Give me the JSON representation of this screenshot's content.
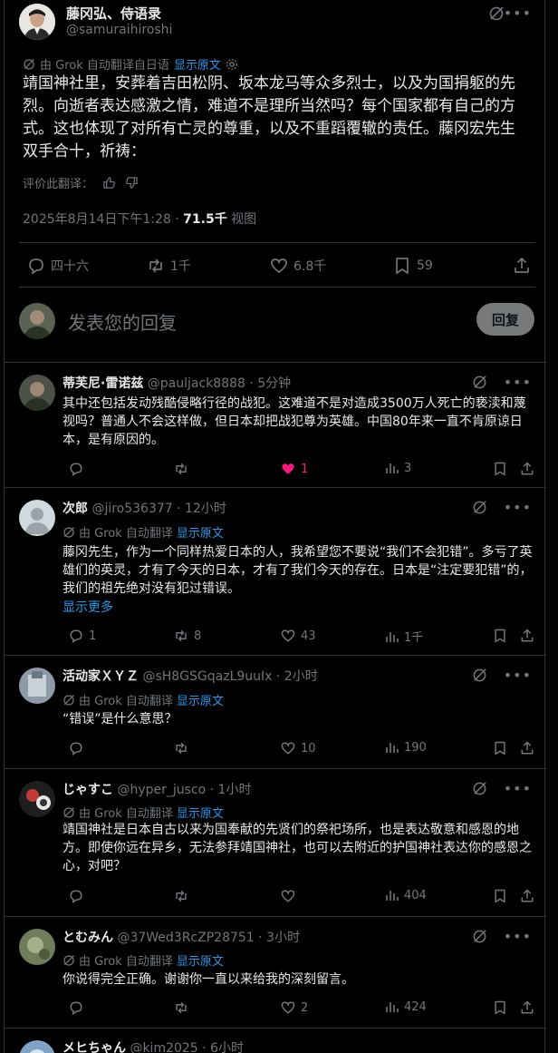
{
  "main": {
    "author_name": "藤冈弘、侍语录",
    "author_handle": "@samuraihiroshi",
    "translated_by": "由 Grok 自动翻译自日语",
    "show_original": "显示原文",
    "text": "靖国神社里，安葬着吉田松阴、坂本龙马等众多烈士，以及为国捐躯的先烈。向逝者表达感激之情，难道不是理所当然吗？每个国家都有自己的方式。这也体现了对所有亡灵的尊重，以及不重蹈覆辙的责任。藤冈宏先生双手合十，祈祷：",
    "rate_translation": "评价此翻译：",
    "timestamp": "2025年8月14日下午1:28",
    "views_count": "71.5千",
    "views_label": "视图",
    "reply_count": "四十六",
    "repost_count": "1千",
    "like_count": "6.8千",
    "bookmark_count": "59"
  },
  "composer": {
    "placeholder": "发表您的回复",
    "button": "回复"
  },
  "replies": [
    {
      "name": "蒂芙尼·雷诺兹",
      "handle": "@pauljack8888",
      "time": "· 5分钟",
      "translated": "",
      "show_original": "",
      "text": "其中还包括发动残酷侵略行径的战犯。这难道不是对造成3500万人死亡的亵渎和蔑视吗？普通人不会这样做，但日本却把战犯尊为英雄。中国80年来一直不肯原谅日本，是有原因的。",
      "show_more": "",
      "replies": "",
      "reposts": "",
      "likes": "1",
      "views": "3"
    },
    {
      "name": "次郎",
      "handle": "@jiro536377",
      "time": "· 12小时",
      "translated": "由 Grok 自动翻译",
      "show_original": "显示原文",
      "text": "藤冈先生，作为一个同样热爱日本的人，我希望您不要说“我们不会犯错”。多亏了英雄们的英灵，才有了今天的日本，才有了我们今天的存在。日本是“注定要犯错”的，我们的祖先绝对没有犯过错误。",
      "show_more": "显示更多",
      "replies": "1",
      "reposts": "8",
      "likes": "43",
      "views": "1千"
    },
    {
      "name": "活动家ＸＹＺ",
      "handle": "@sH8GSGqazL9uuIx",
      "time": "· 2小时",
      "translated": "由 Grok 自动翻译",
      "show_original": "显示原文",
      "text": "“错误”是什么意思？",
      "show_more": "",
      "replies": "",
      "reposts": "",
      "likes": "10",
      "views": "190"
    },
    {
      "name": "じゃすこ",
      "handle": "@hyper_jusco",
      "time": "· 1小时",
      "translated": "由 Grok 自动翻译",
      "show_original": "显示原文",
      "text": "靖国神社是日本自古以来为国奉献的先贤们的祭祀场所，也是表达敬意和感恩的地方。即使你远在异乡，无法参拜靖国神社，也可以去附近的护国神社表达你的感恩之心，对吧？",
      "show_more": "",
      "replies": "",
      "reposts": "",
      "likes": "",
      "views": "404"
    },
    {
      "name": "とむみん",
      "handle": "@37Wed3RcZP28751",
      "time": "· 3小时",
      "translated": "由 Grok 自动翻译",
      "show_original": "显示原文",
      "text": "你说得完全正确。谢谢你一直以来给我的深刻留言。",
      "show_more": "",
      "replies": "",
      "reposts": "",
      "likes": "2",
      "views": "424"
    },
    {
      "name": "メヒちゃん",
      "handle": "@kim2025",
      "time": "· 6小时"
    }
  ],
  "colors": {
    "accent": "#1d9bf0",
    "like_active": "#f91880",
    "muted": "#71767b",
    "border": "#2f3336"
  }
}
